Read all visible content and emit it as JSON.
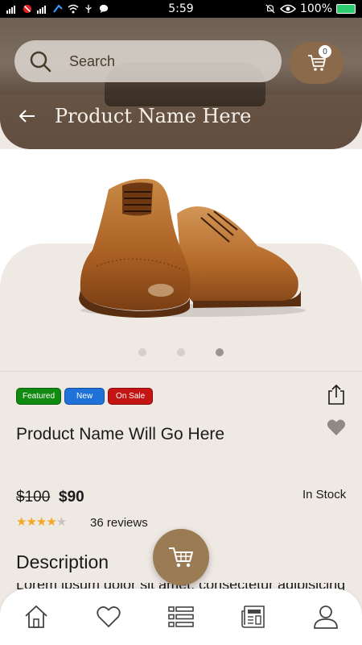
{
  "status_bar": {
    "time": "5:59",
    "battery": "100%"
  },
  "header": {
    "search_label": "Search",
    "cart_count": "0",
    "title": "Product Name Here"
  },
  "gallery": {
    "dot_count": 3,
    "active_index": 2
  },
  "badges": [
    {
      "label": "Featured",
      "color": "#118a11"
    },
    {
      "label": "New",
      "color": "#1e72d8"
    },
    {
      "label": "On Sale",
      "color": "#c41414"
    }
  ],
  "product": {
    "name": "Product Name Will Go Here",
    "old_price": "$100",
    "price": "$90",
    "stock": "In Stock",
    "rating": 4,
    "rating_max": 5,
    "stars_filled": "★★★★",
    "stars_empty": "★",
    "reviews": "36 reviews"
  },
  "description": {
    "title": "Description",
    "peek": "Lorem ipsum dolor sit amet, consectetur adipisicing"
  },
  "colors": {
    "accent": "#9a7b54",
    "cart_button": "#8a6a4a",
    "star": "#f5a623",
    "background": "#efe9e4"
  },
  "nav": {
    "items": [
      "home-icon",
      "heart-icon",
      "list-icon",
      "news-icon",
      "user-icon"
    ]
  }
}
